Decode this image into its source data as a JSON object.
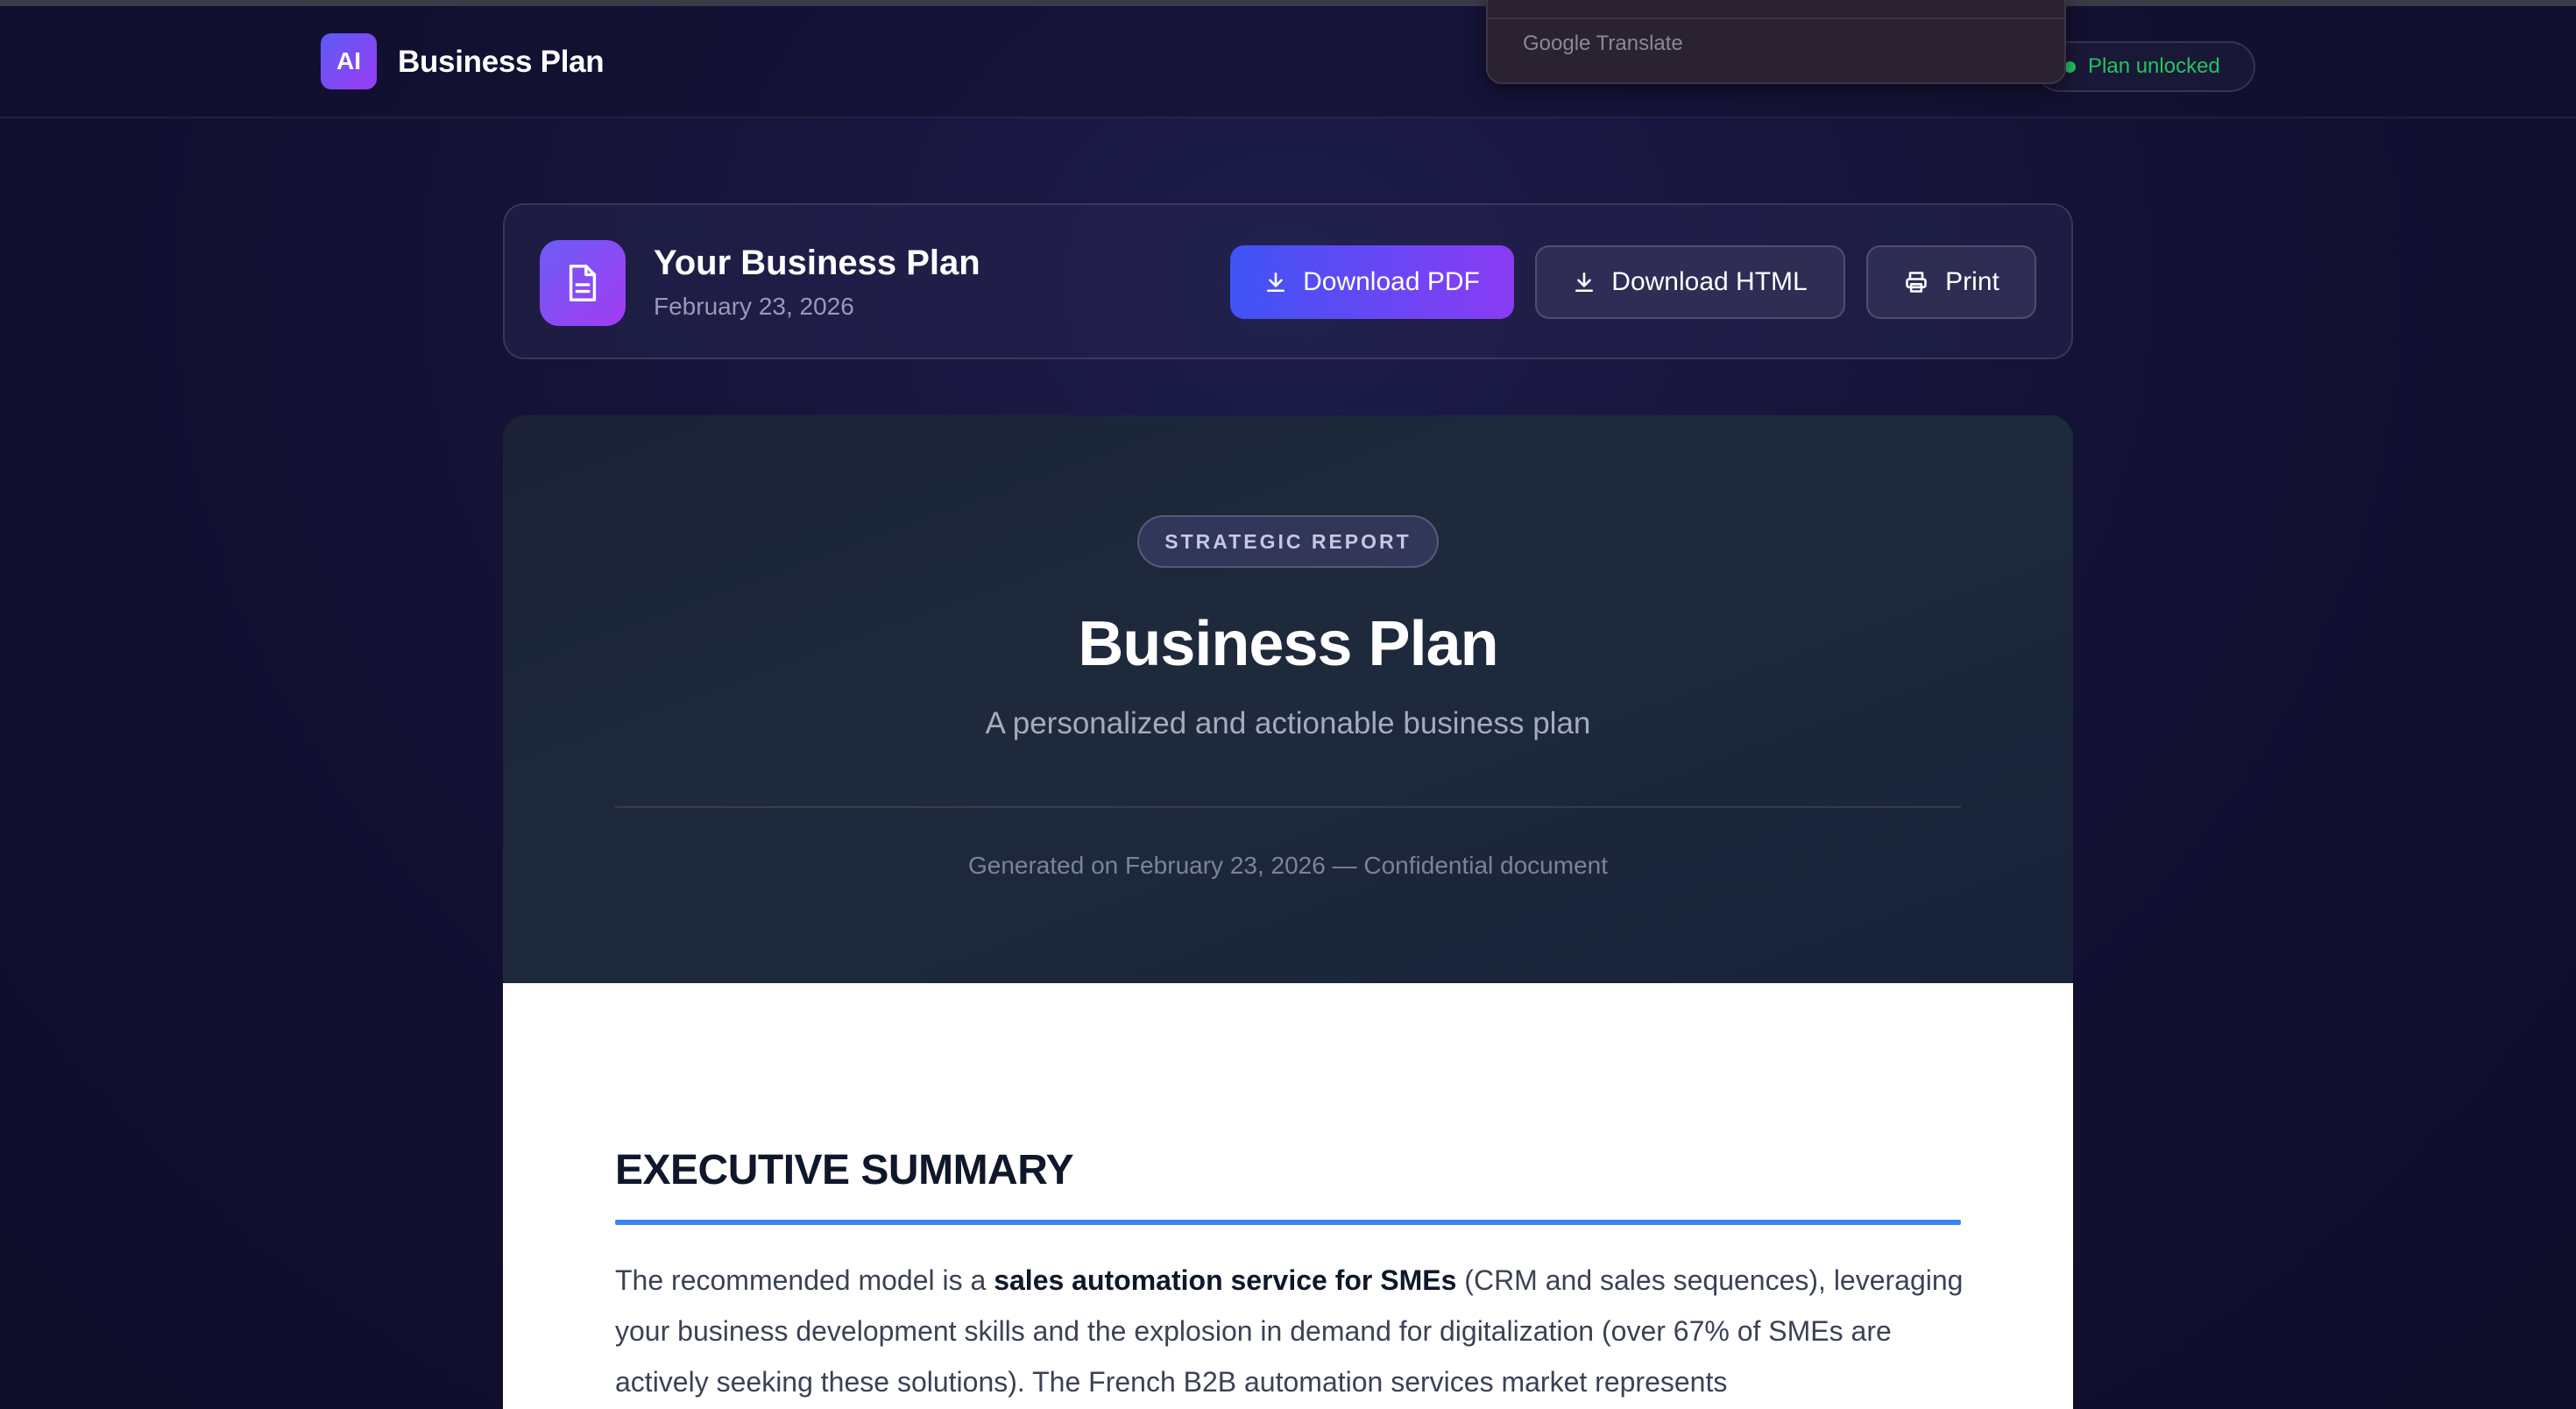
{
  "header": {
    "logo_text": "AI",
    "app_title": "Business Plan",
    "status": "Plan unlocked",
    "status_color": "#22c55e"
  },
  "google_translate": {
    "brand": "Google Translate"
  },
  "toolbar": {
    "title": "Your Business Plan",
    "date": "February 23, 2026",
    "download_pdf": "Download PDF",
    "download_html": "Download HTML",
    "print": "Print"
  },
  "hero": {
    "tag": "STRATEGIC REPORT",
    "title": "Business Plan",
    "subtitle": "A personalized and actionable business plan",
    "meta": "Generated on February 23, 2026 — Confidential document"
  },
  "content": {
    "section_title": "EXECUTIVE SUMMARY",
    "para_1": "The recommended model is a ",
    "para_bold": "sales automation service for SMEs",
    "para_2": " (CRM and sales sequences), leveraging your business development skills and the explosion in demand for digitalization (over 67% of SMEs are actively seeking these solutions). The French B2B automation services market represents"
  },
  "colors": {
    "accent": "#3b82f6",
    "primary_gradient_start": "#3f54f5",
    "primary_gradient_end": "#8a3cf3"
  }
}
